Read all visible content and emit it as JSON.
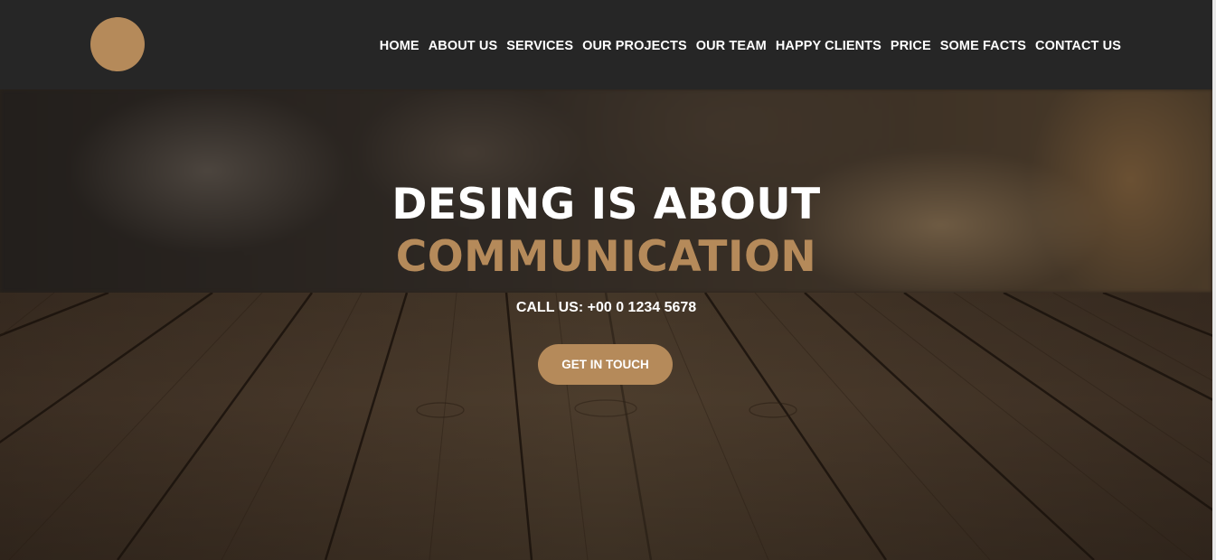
{
  "header": {
    "nav": [
      {
        "label": "HOME"
      },
      {
        "label": "ABOUT US"
      },
      {
        "label": "SERVICES"
      },
      {
        "label": "OUR PROJECTS"
      },
      {
        "label": "OUR TEAM"
      },
      {
        "label": "HAPPY CLIENTS"
      },
      {
        "label": "PRICE"
      },
      {
        "label": "SOME FACTS"
      },
      {
        "label": "CONTACT US"
      }
    ]
  },
  "hero": {
    "headline": "DESING IS ABOUT",
    "headline_accent": "COMMUNICATION",
    "call_text": "CALL US: +00 0 1234 5678",
    "cta_label": "GET IN TOUCH"
  },
  "colors": {
    "header_bg": "#262626",
    "accent": "#b58a5a",
    "text": "#ffffff"
  }
}
